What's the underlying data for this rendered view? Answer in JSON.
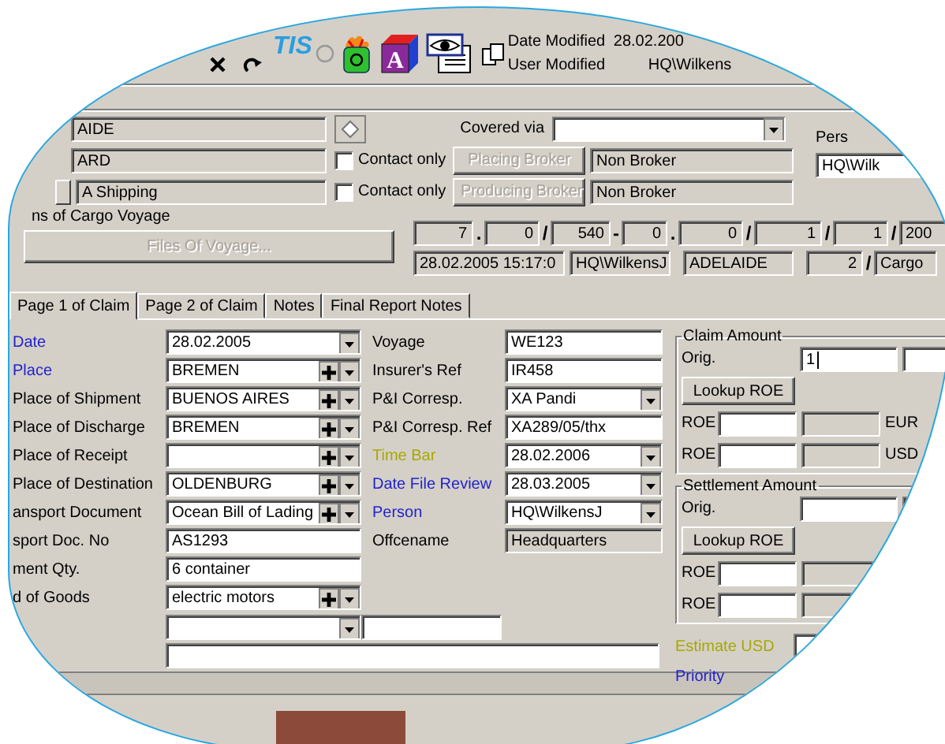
{
  "toolbar": {
    "logo": "TIS",
    "cube_letter": "A",
    "date_modified_label": "Date Modified",
    "date_modified": "28.02.200",
    "user_modified_label": "User Modified",
    "user_modified": "HQ\\Wilkens"
  },
  "header": {
    "first_field": "AIDE",
    "covered_via_label": "Covered via",
    "pers_label": "Pers",
    "pers_value": "HQ\\Wilk",
    "broker_rows": [
      {
        "value": "ARD",
        "contact_label": "Contact only",
        "contact_checked": false,
        "button": "Placing Broker",
        "broker": "Non Broker"
      },
      {
        "value": "A Shipping",
        "contact_label": "Contact only",
        "contact_checked": false,
        "button": "Producing Broker",
        "broker": "Non Broker"
      }
    ]
  },
  "voyage": {
    "group_label": "ns of Cargo Voyage",
    "files_button": "Files Of Voyage...",
    "number_row": [
      {
        "kind": "field",
        "text": "7"
      },
      {
        "kind": "sep",
        "text": "."
      },
      {
        "kind": "field",
        "text": "0"
      },
      {
        "kind": "sep",
        "text": "/"
      },
      {
        "kind": "field",
        "text": "540"
      },
      {
        "kind": "sep",
        "text": "-"
      },
      {
        "kind": "field",
        "text": "0"
      },
      {
        "kind": "sep",
        "text": "."
      },
      {
        "kind": "field",
        "text": "0"
      },
      {
        "kind": "sep",
        "text": "/"
      },
      {
        "kind": "field",
        "text": "1"
      },
      {
        "kind": "sep",
        "text": "/"
      },
      {
        "kind": "field",
        "text": "1"
      },
      {
        "kind": "sep",
        "text": "/"
      },
      {
        "kind": "field",
        "text": "200"
      }
    ],
    "info_row": [
      {
        "kind": "field",
        "text": "28.02.2005 15:17:0"
      },
      {
        "kind": "field",
        "text": "HQ\\WilkensJ"
      },
      {
        "kind": "field",
        "text": "ADELAIDE"
      },
      {
        "kind": "field",
        "text": "2"
      },
      {
        "kind": "sep",
        "text": "/"
      },
      {
        "kind": "field",
        "text": "Cargo"
      }
    ]
  },
  "tabs": [
    {
      "label": "Page 1 of Claim",
      "selected": true
    },
    {
      "label": "Page 2 of Claim",
      "selected": false
    },
    {
      "label": "Notes",
      "selected": false
    },
    {
      "label": "Final Report Notes",
      "selected": false
    }
  ],
  "left_fields": [
    {
      "label": "Date",
      "color": "#2222cc",
      "kind": "combo",
      "value": "28.02.2005"
    },
    {
      "label": "Place",
      "color": "#2222cc",
      "kind": "combo_plus",
      "value": "BREMEN"
    },
    {
      "label": "Place of Shipment",
      "color": "#000000",
      "kind": "combo_plus",
      "value": "BUENOS AIRES"
    },
    {
      "label": "Place of Discharge",
      "color": "#000000",
      "kind": "combo_plus",
      "value": "BREMEN"
    },
    {
      "label": "Place of Receipt",
      "color": "#000000",
      "kind": "combo_plus"
    },
    {
      "label": "Place of Destination",
      "color": "#000000",
      "kind": "combo_plus",
      "value": "OLDENBURG"
    },
    {
      "label": "ansport Document",
      "color": "#000000",
      "kind": "combo_plus",
      "value": "Ocean Bill of Lading"
    },
    {
      "label": "sport Doc. No",
      "color": "#000000",
      "kind": "text",
      "value": "AS1293"
    },
    {
      "label": "ment Qty.",
      "color": "#000000",
      "kind": "text",
      "value": "6 container"
    },
    {
      "label": "d of Goods",
      "color": "#000000",
      "kind": "combo_plus",
      "value": "electric motors"
    }
  ],
  "mid_fields": [
    {
      "label": "Voyage",
      "color": "#000000",
      "kind": "text",
      "value": "WE123"
    },
    {
      "label": "Insurer's Ref",
      "color": "#000000",
      "kind": "text",
      "value": "IR458"
    },
    {
      "label": "P&I Corresp.",
      "color": "#000000",
      "kind": "combo",
      "value": "XA Pandi"
    },
    {
      "label": "P&I Corresp. Ref",
      "color": "#000000",
      "kind": "text",
      "value": "XA289/05/thx"
    },
    {
      "label": "Time Bar",
      "color": "#a8a800",
      "kind": "combo",
      "value": "28.02.2006"
    },
    {
      "label": "Date File Review",
      "color": "#2222cc",
      "kind": "combo",
      "value": "28.03.2005"
    },
    {
      "label": "Person",
      "color": "#2222cc",
      "kind": "combo",
      "value": "HQ\\WilkensJ"
    },
    {
      "label": "Offcename",
      "color": "#000000",
      "kind": "readonly",
      "value": "Headquarters"
    }
  ],
  "claim_amount": {
    "title": "Claim Amount",
    "orig_label": "Orig.",
    "orig": "1",
    "focused": true,
    "lookup_button": "Lookup ROE",
    "roe_rows": [
      {
        "label": "ROE",
        "currency": "EUR"
      },
      {
        "label": "ROE",
        "currency": "USD"
      }
    ]
  },
  "settlement_amount": {
    "title": "Settlement Amount",
    "orig_label": "Orig.",
    "lookup_button": "Lookup ROE",
    "roe_rows": [
      {
        "label": "ROE"
      },
      {
        "label": "ROE"
      }
    ]
  },
  "extra_fields": [
    {
      "label": "Estimate USD",
      "color": "#a8a800"
    },
    {
      "label": "Priority",
      "color": "#2222cc"
    }
  ]
}
